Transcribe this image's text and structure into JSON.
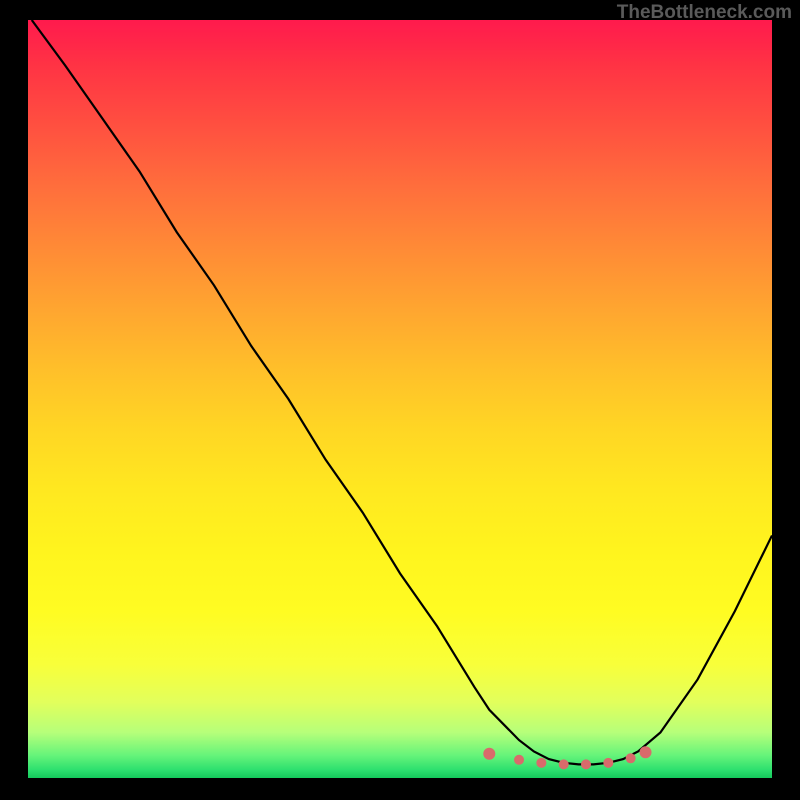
{
  "watermark": "TheBottleneck.com",
  "chart_data": {
    "type": "line",
    "title": "",
    "xlabel": "",
    "ylabel": "",
    "xlim": [
      0,
      100
    ],
    "ylim": [
      0,
      100
    ],
    "x": [
      0.5,
      5,
      10,
      15,
      20,
      25,
      30,
      35,
      40,
      45,
      50,
      55,
      60,
      62,
      64,
      66,
      68,
      70,
      72,
      74,
      76,
      78,
      80,
      82,
      85,
      90,
      95,
      100
    ],
    "values": [
      100,
      94,
      87,
      80,
      72,
      65,
      57,
      50,
      42,
      35,
      27,
      20,
      12,
      9,
      7,
      5,
      3.5,
      2.5,
      2,
      1.8,
      1.8,
      2,
      2.5,
      3.5,
      6,
      13,
      22,
      32
    ],
    "markers_x": [
      62,
      66,
      69,
      72,
      75,
      78,
      81,
      83
    ],
    "markers_y": [
      3.2,
      2.4,
      2.0,
      1.8,
      1.8,
      2.0,
      2.6,
      3.4
    ],
    "gradient_colors": {
      "top": "#ff1a4d",
      "mid_upper": "#ffa530",
      "mid": "#fff41e",
      "mid_lower": "#b6ff7a",
      "bottom": "#14c95c"
    }
  }
}
